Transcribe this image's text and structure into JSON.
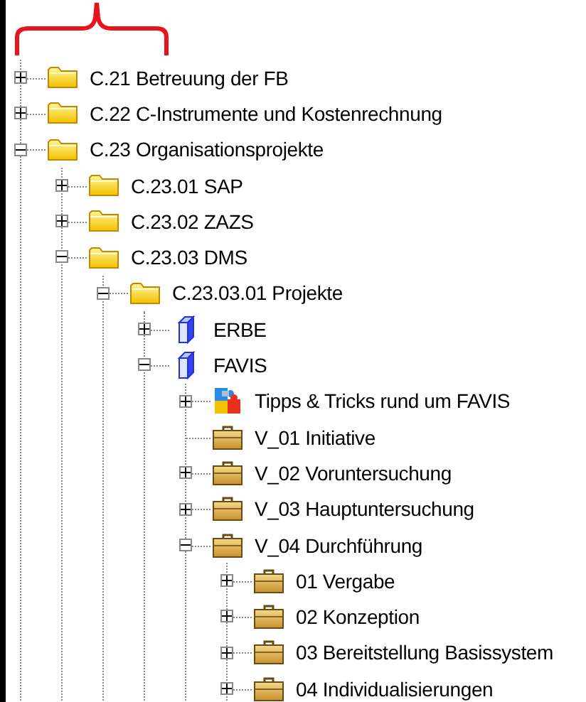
{
  "tree": [
    {
      "label": "C.21 Betreuung der FB",
      "kind": "folder",
      "has_children": true,
      "expanded": false
    },
    {
      "label": "C.22 C-Instrumente und Kostenrechnung",
      "kind": "folder",
      "has_children": true,
      "expanded": false
    },
    {
      "label": "C.23 Organisationsprojekte",
      "kind": "folder",
      "has_children": true,
      "expanded": true,
      "children": [
        {
          "label": "C.23.01 SAP",
          "kind": "folder",
          "has_children": true,
          "expanded": false
        },
        {
          "label": "C.23.02 ZAZS",
          "kind": "folder",
          "has_children": true,
          "expanded": false
        },
        {
          "label": "C.23.03 DMS",
          "kind": "folder",
          "has_children": true,
          "expanded": true,
          "children": [
            {
              "label": "C.23.03.01 Projekte",
              "kind": "folder",
              "has_children": true,
              "expanded": true,
              "children": [
                {
                  "label": "ERBE",
                  "kind": "book",
                  "has_children": true,
                  "expanded": false
                },
                {
                  "label": "FAVIS",
                  "kind": "book",
                  "has_children": true,
                  "expanded": true,
                  "children": [
                    {
                      "label": "Tipps & Tricks rund um FAVIS",
                      "kind": "puzzle",
                      "has_children": true,
                      "expanded": false
                    },
                    {
                      "label": "V_01 Initiative",
                      "kind": "briefcase",
                      "has_children": false
                    },
                    {
                      "label": "V_02 Voruntersuchung",
                      "kind": "briefcase",
                      "has_children": true,
                      "expanded": false
                    },
                    {
                      "label": "V_03 Hauptuntersuchung",
                      "kind": "briefcase",
                      "has_children": true,
                      "expanded": false
                    },
                    {
                      "label": "V_04 Durchführung",
                      "kind": "briefcase",
                      "has_children": true,
                      "expanded": true,
                      "children": [
                        {
                          "label": "01 Vergabe",
                          "kind": "briefcase",
                          "has_children": true,
                          "expanded": false
                        },
                        {
                          "label": "02 Konzeption",
                          "kind": "briefcase",
                          "has_children": true,
                          "expanded": false
                        },
                        {
                          "label": "03 Bereitstellung Basissystem",
                          "kind": "briefcase",
                          "has_children": true,
                          "expanded": false
                        },
                        {
                          "label": "04 Individualisierungen",
                          "kind": "briefcase",
                          "has_children": true,
                          "expanded": false
                        }
                      ]
                    }
                  ]
                }
              ]
            }
          ]
        }
      ]
    }
  ]
}
